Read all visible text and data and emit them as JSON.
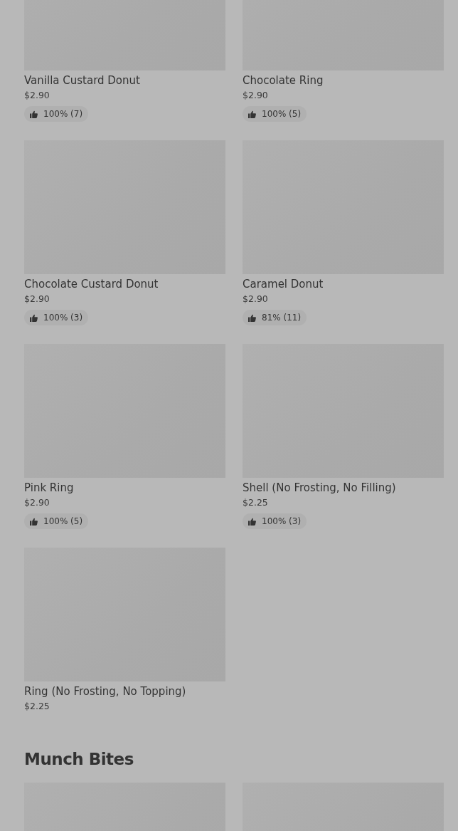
{
  "sections": [
    {
      "items": [
        {
          "name": "Vanilla Custard Donut",
          "price": "$2.90",
          "rating": "100% (7)"
        },
        {
          "name": "Chocolate Ring",
          "price": "$2.90",
          "rating": "100% (5)"
        },
        {
          "name": "Chocolate Custard Donut",
          "price": "$2.90",
          "rating": "100% (3)"
        },
        {
          "name": "Caramel Donut",
          "price": "$2.90",
          "rating": "81% (11)"
        },
        {
          "name": "Pink Ring",
          "price": "$2.90",
          "rating": "100% (5)"
        },
        {
          "name": "Shell (No Frosting, No Filling)",
          "price": "$2.25",
          "rating": "100% (3)"
        },
        {
          "name": "Ring (No Frosting, No Topping)",
          "price": "$2.25"
        }
      ]
    },
    {
      "title": "Munch Bites"
    }
  ]
}
